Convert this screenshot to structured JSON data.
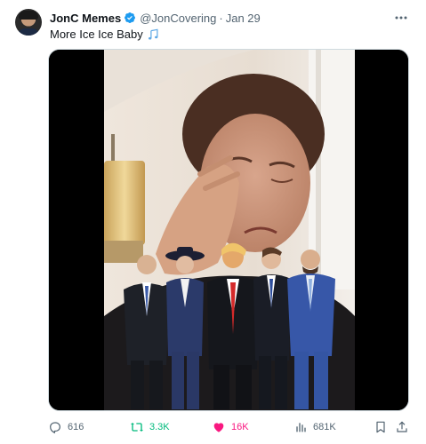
{
  "tweet": {
    "author_name": "JonC Memes",
    "handle": "@JonCovering",
    "separator": "·",
    "date": "Jan 29",
    "text": "More Ice Ice Baby",
    "text_emoji": "musical-notes-icon"
  },
  "stats": {
    "replies": "616",
    "retweets": "3.3K",
    "likes": "16K",
    "views": "681K"
  },
  "colors": {
    "text": "#0f1419",
    "secondary": "#536471",
    "verified": "#1d9bf0",
    "retweet": "#00ba7c",
    "like": "#f91880"
  }
}
